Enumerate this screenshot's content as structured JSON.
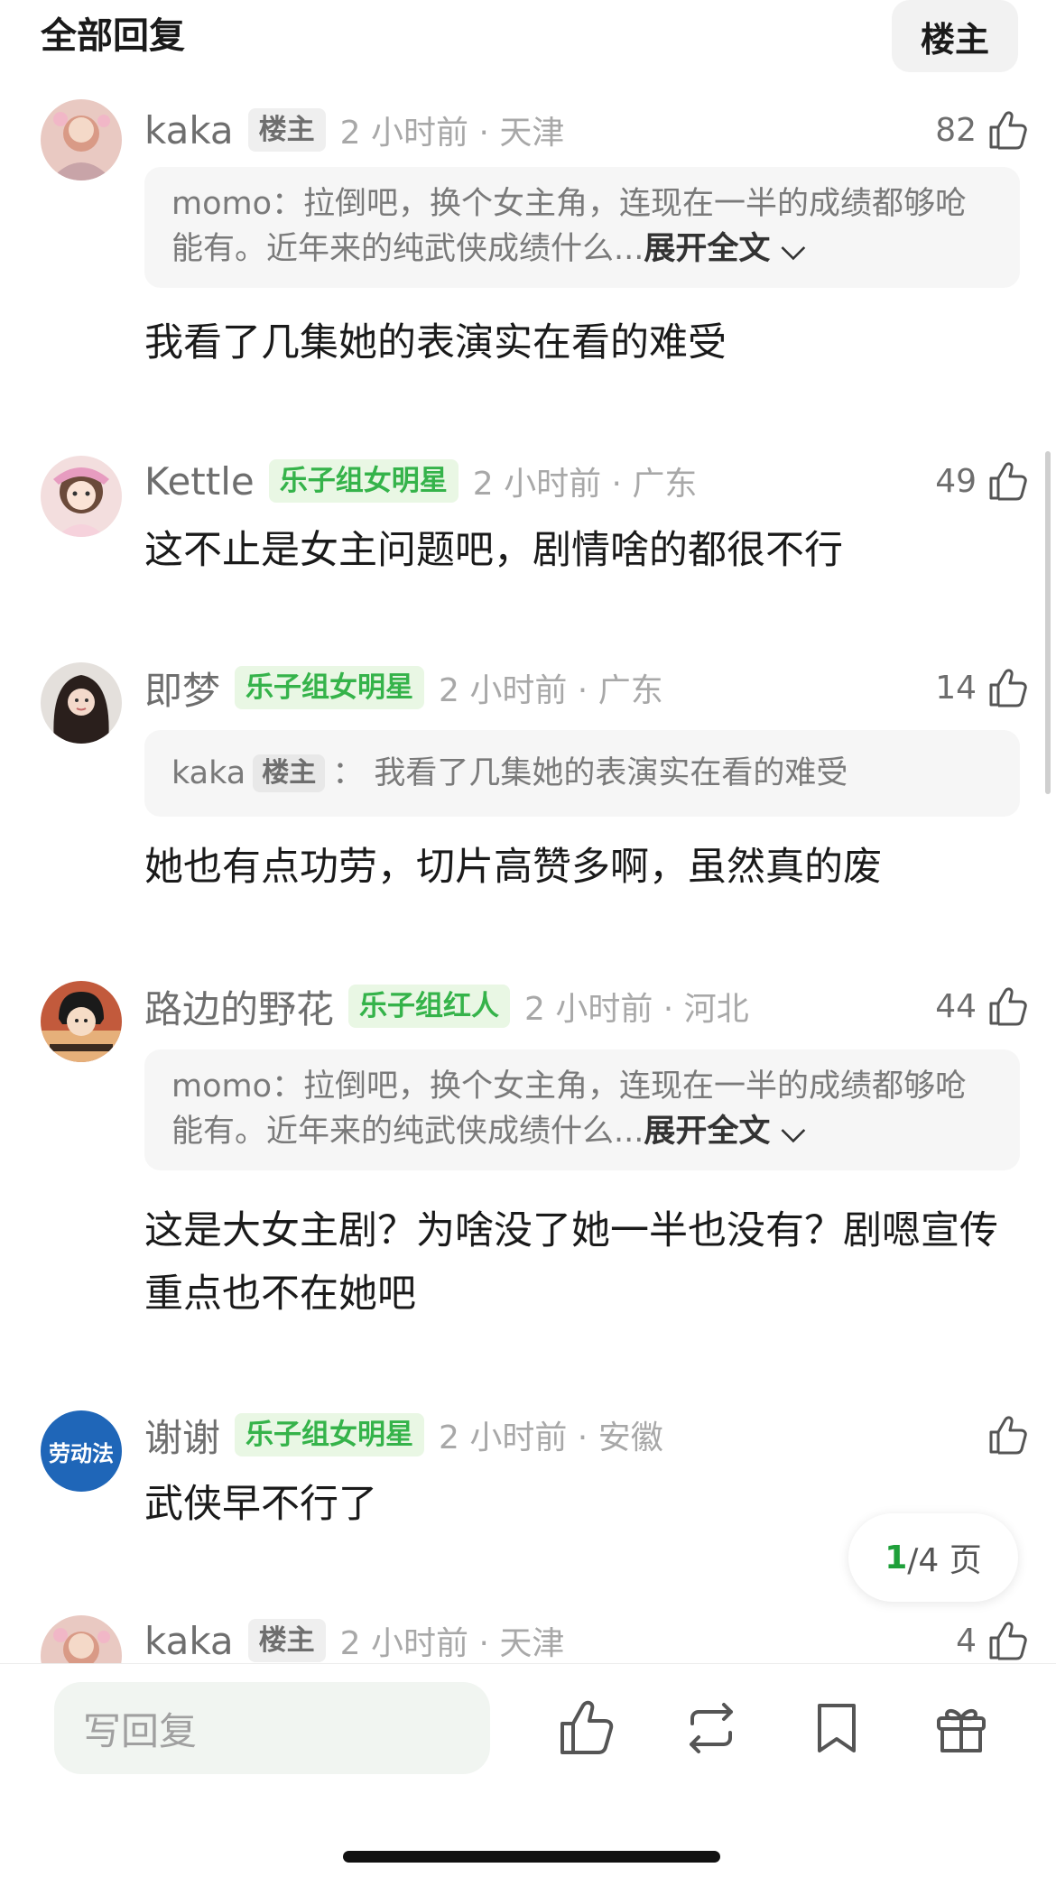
{
  "header": {
    "title": "全部回复",
    "filter_label": "楼主"
  },
  "comments": [
    {
      "username": "kaka",
      "badge": "楼主",
      "time_loc": "2 小时前 · 天津",
      "likes": "82",
      "quote_user": "momo",
      "quote_text": "：拉倒吧，换个女主角，连现在一半的成绩都够呛能有。近年来的纯武侠成绩什么...",
      "quote_expand": "展开全文",
      "body": "我看了几集她的表演实在看的难受"
    },
    {
      "username": "Kettle",
      "badge": "乐子组女明星",
      "time_loc": "2 小时前 · 广东",
      "likes": "49",
      "body": "这不止是女主问题吧，剧情啥的都很不行"
    },
    {
      "username": "即梦",
      "badge": "乐子组女明星",
      "time_loc": "2 小时前 · 广东",
      "likes": "14",
      "quote_user": "kaka",
      "quote_badge": "楼主",
      "quote_text": "： 我看了几集她的表演实在看的难受",
      "body": "她也有点功劳，切片高赞多啊，虽然真的废"
    },
    {
      "username": "路边的野花",
      "badge": "乐子组红人",
      "time_loc": "2 小时前 · 河北",
      "likes": "44",
      "quote_user": "momo",
      "quote_text": "：拉倒吧，换个女主角，连现在一半的成绩都够呛能有。近年来的纯武侠成绩什么...",
      "quote_expand": "展开全文",
      "body": "这是大女主剧？为啥没了她一半也没有？剧嗯宣传重点也不在她吧"
    },
    {
      "username": "谢谢",
      "badge": "乐子组女明星",
      "time_loc": "2 小时前 · 安徽",
      "likes": "",
      "avatar_text": "劳动法",
      "body": "武侠早不行了"
    },
    {
      "username": "kaka",
      "badge": "楼主",
      "time_loc": "2 小时前 · 天津",
      "likes": "4"
    }
  ],
  "pagination": {
    "current": "1",
    "total": "/4 页"
  },
  "bottom_bar": {
    "reply_placeholder": "写回复",
    "icons": [
      "like-icon",
      "repost-icon",
      "bookmark-icon",
      "gift-icon"
    ]
  },
  "colors": {
    "green_badge_text": "#35b34a",
    "page_current": "#1fa03a"
  }
}
